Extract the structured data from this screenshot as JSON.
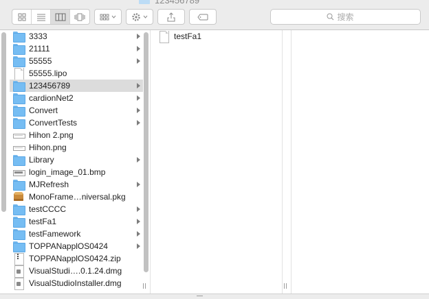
{
  "window": {
    "title": "123456789"
  },
  "toolbar": {
    "view_buttons": [
      "icon-view",
      "list-view",
      "column-view",
      "cover-flow-view"
    ],
    "active_view": "column-view",
    "search_placeholder": "搜索"
  },
  "column1": {
    "items": [
      {
        "name": "3333",
        "kind": "folder",
        "has_children": true
      },
      {
        "name": "21111",
        "kind": "folder",
        "has_children": true
      },
      {
        "name": "55555",
        "kind": "folder",
        "has_children": true
      },
      {
        "name": "55555.lipo",
        "kind": "document",
        "has_children": false
      },
      {
        "name": "123456789",
        "kind": "folder",
        "has_children": true,
        "selected": true
      },
      {
        "name": "cardionNet2",
        "kind": "folder",
        "has_children": true
      },
      {
        "name": "Convert",
        "kind": "folder",
        "has_children": true
      },
      {
        "name": "ConvertTests",
        "kind": "folder",
        "has_children": true
      },
      {
        "name": "Hihon 2.png",
        "kind": "image",
        "has_children": false
      },
      {
        "name": "Hihon.png",
        "kind": "image",
        "has_children": false
      },
      {
        "name": "Library",
        "kind": "folder",
        "has_children": true
      },
      {
        "name": "login_image_01.bmp",
        "kind": "bitmap",
        "has_children": false
      },
      {
        "name": "MJRefresh",
        "kind": "folder",
        "has_children": true
      },
      {
        "name": "MonoFrame…niversal.pkg",
        "kind": "package",
        "has_children": false
      },
      {
        "name": "testCCCC",
        "kind": "folder",
        "has_children": true
      },
      {
        "name": "testFa1",
        "kind": "folder",
        "has_children": true
      },
      {
        "name": "testFamework",
        "kind": "folder",
        "has_children": true
      },
      {
        "name": "TOPPANapplOS0424",
        "kind": "folder",
        "has_children": true
      },
      {
        "name": "TOPPANapplOS0424.zip",
        "kind": "archive",
        "has_children": false
      },
      {
        "name": "VisualStudi….0.1.24.dmg",
        "kind": "disk-image",
        "has_children": false
      },
      {
        "name": "VisualStudioInstaller.dmg",
        "kind": "disk-image",
        "has_children": false
      }
    ]
  },
  "column2": {
    "items": [
      {
        "name": "testFa1",
        "kind": "document",
        "has_children": false
      }
    ]
  },
  "colors": {
    "toolbar_bg": "#ececec",
    "folder_blue": "#76bdf3",
    "selection_gray": "#dcdcdc"
  }
}
